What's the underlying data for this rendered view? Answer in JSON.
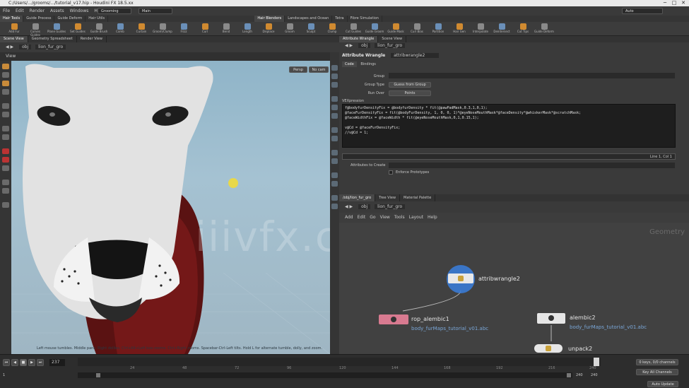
{
  "window": {
    "title": "C:/Users/.../grooms/.../tutorial_v17.hip - Houdini FX 18.5.xx",
    "minimize_glyph": "─",
    "maximize_glyph": "□",
    "close_glyph": "✕"
  },
  "menubar": {
    "items": [
      "File",
      "Edit",
      "Render",
      "Assets",
      "Windows",
      "Help"
    ],
    "desktop": "Grooming",
    "main_tab": "Main",
    "auto_update": "Auto"
  },
  "shelf_tabs": {
    "left": [
      "Hair Tools",
      "Guide Process",
      "Guide Deform",
      "Hair Utils"
    ],
    "right": [
      "Hair Blenders",
      "Landscapes and Ocean",
      "Tetra",
      "Fibre Simulation"
    ]
  },
  "shelf_tools": [
    "Add Fur",
    "Curves Guides",
    "Plane Guides",
    "Set Guides",
    "Guide Brush",
    "Comb",
    "Curtain",
    "Groom/Clump",
    "Frizz",
    "Curl",
    "Bend",
    "Length",
    "Displace",
    "Groom",
    "Sculpt",
    "Clump",
    "Cut Guides",
    "Guide Groom",
    "Guide Mask",
    "Curl Bias",
    "Partition",
    "Hair Gen",
    "Interpolate",
    "Deintersect",
    "Cut Tips",
    "Guide Deform"
  ],
  "left_pane": {
    "tabs": [
      "Scene View",
      "Geometry Spreadsheet",
      "Render View"
    ],
    "path": [
      "obj",
      "lion_fur_gro"
    ],
    "view_title": "View",
    "persp": "Persp",
    "cam": "No cam",
    "status": "Left mouse tumbles. Middle pans. Right dollies. Ctrl+Alt+Left box-zooms. Ctrl+Right zooms. Spacebar-Ctrl-Left tilts. Hold L for alternate tumble, dolly, and zoom."
  },
  "right_pane": {
    "tabs": [
      "Attribute Wrangle",
      "Scene View"
    ],
    "path": [
      "obj",
      "lion_fur_gro"
    ],
    "node_type": "Attribute Wrangle",
    "node_name": "attribwrangle2",
    "param_tabs": [
      "Code",
      "Bindings"
    ],
    "group_label": "Group",
    "group_type_label": "Group Type",
    "group_type_value": "Guess from Group",
    "run_over_label": "Run Over",
    "run_over_value": "Points",
    "vex_label": "VEXpression",
    "code_lines": [
      "f@bodyfurDensityFix = @bodyfurDensity * fit(@pawPadMask,0.3,1,0,1);",
      "@faceFurDensityFix = fit(@bodyFurDensity, 1, 0, 0, 1)*@eyeNoseMouthMask*@faceDensity*@whiskerMask*@scratchMask;",
      "@faceWidthFix = @faceWidth * fit(@eyeNoseMouthMask,0,1,0.15,1);",
      "",
      "v@Cd = @faceFurDensityFix;",
      "//v@Cd = 1;"
    ],
    "code_status": "Line 1, Col 1",
    "attr_create_label": "Attributes to Create",
    "enforce_label": "Enforce Prototypes"
  },
  "network_pane": {
    "tabs": [
      "/obj/lion_fur_gro",
      "Tree View",
      "Material Palette"
    ],
    "path": [
      "obj",
      "lion_fur_gro"
    ],
    "menu": [
      "Add",
      "Edit",
      "Go",
      "View",
      "Tools",
      "Layout",
      "Help"
    ],
    "context_label": "Geometry",
    "nodes": [
      {
        "name": "attribwrangle2",
        "sub": ""
      },
      {
        "name": "rop_alembic1",
        "sub": "body_furMaps_tutorial_v01.abc"
      },
      {
        "name": "alembic2",
        "sub": "body_furMaps_tutorial_v01.abc"
      },
      {
        "name": "unpack2",
        "sub": ""
      }
    ]
  },
  "timeline": {
    "frame": "237",
    "start": "1",
    "end": "240",
    "range_end": "240",
    "ticks": [
      "24",
      "48",
      "72",
      "96",
      "120",
      "144",
      "168",
      "192",
      "216",
      "240"
    ],
    "keys_label": "0 keys, 0/0 channels",
    "key_all_label": "Key All Channels",
    "auto_update_label": "Auto Update"
  },
  "watermark": "iiivfx.com",
  "colors": {
    "accent_orange": "#d08a30",
    "node_blue": "#3a7bd5",
    "node_pink": "#d87a90",
    "link_blue": "#7aa7d8"
  }
}
